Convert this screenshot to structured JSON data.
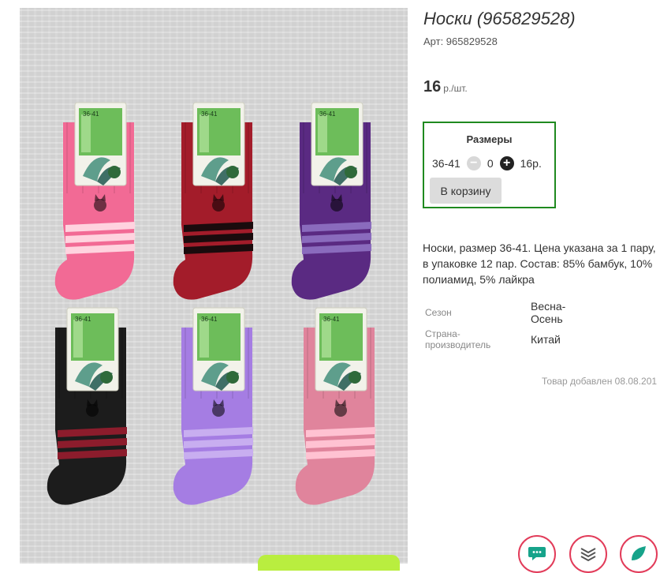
{
  "product": {
    "title": "Носки (965829528)",
    "article": "Арт: 965829528",
    "price_value": "16",
    "price_unit": "р./шт.",
    "description": "Носки, размер 36-41. Цена указана за 1 пару, в упаковке 12 пар. Состав: 85% бамбук, 10% полиамид, 5% лайкра",
    "added": "Товар добавлен 08.08.201"
  },
  "sizes": {
    "heading": "Размеры",
    "size_label": "36-41",
    "minus": "−",
    "quantity": "0",
    "plus": "+",
    "sum": "16р.",
    "cart_button": "В корзину"
  },
  "properties": [
    {
      "label": "Сезон",
      "value_line1": "Весна-",
      "value_line2": "Осень"
    },
    {
      "label_line1": "Страна-",
      "label_line2": "производитель",
      "value": "Китай"
    }
  ],
  "photo": {
    "tag_size": "36-41",
    "sock_colors": [
      "#f26a95",
      "#a31c2a",
      "#5a2a82",
      "#1c1c1c",
      "#a57de3",
      "#e0849c"
    ],
    "stripe_colors": [
      "#ffd3df",
      "#1a0b0d",
      "#8a6bbd",
      "#8c1c2c",
      "#c8aef0",
      "#ffc2d2"
    ]
  },
  "fab_buttons": [
    "chat-icon",
    "layers-icon",
    "leaf-icon"
  ],
  "colors": {
    "accent_green": "#1f8a1f",
    "fab_border": "#e23c5a",
    "cart_button": "#dcdcdc"
  }
}
